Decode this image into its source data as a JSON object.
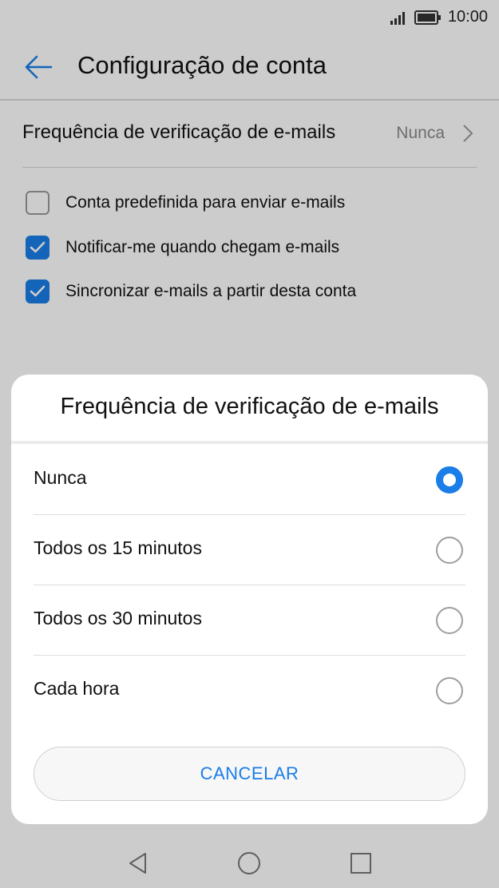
{
  "status_bar": {
    "time": "10:00",
    "signal_icon": "signal-icon",
    "battery_icon": "battery-icon"
  },
  "app_bar": {
    "title": "Configuração de conta",
    "back_icon": "back-arrow-icon"
  },
  "settings": {
    "frequency_label": "Frequência de verificação de e-mails",
    "frequency_value": "Nunca",
    "checkboxes": [
      {
        "label": "Conta predefinida para enviar e-mails",
        "checked": false
      },
      {
        "label": "Notificar-me quando chegam e-mails",
        "checked": true
      },
      {
        "label": "Sincronizar e-mails a partir desta conta",
        "checked": true
      }
    ]
  },
  "dialog": {
    "title": "Frequência de verificação de e-mails",
    "options": [
      {
        "label": "Nunca",
        "selected": true
      },
      {
        "label": "Todos os 15 minutos",
        "selected": false
      },
      {
        "label": "Todos os 30 minutos",
        "selected": false
      },
      {
        "label": "Cada hora",
        "selected": false
      }
    ],
    "cancel_label": "CANCELAR"
  },
  "nav_bar": {
    "back_icon": "nav-back-icon",
    "home_icon": "nav-home-icon",
    "recents_icon": "nav-recents-icon"
  },
  "colors": {
    "accent": "#1a7de8",
    "scrim": "rgba(0,0,0,0.2)"
  }
}
